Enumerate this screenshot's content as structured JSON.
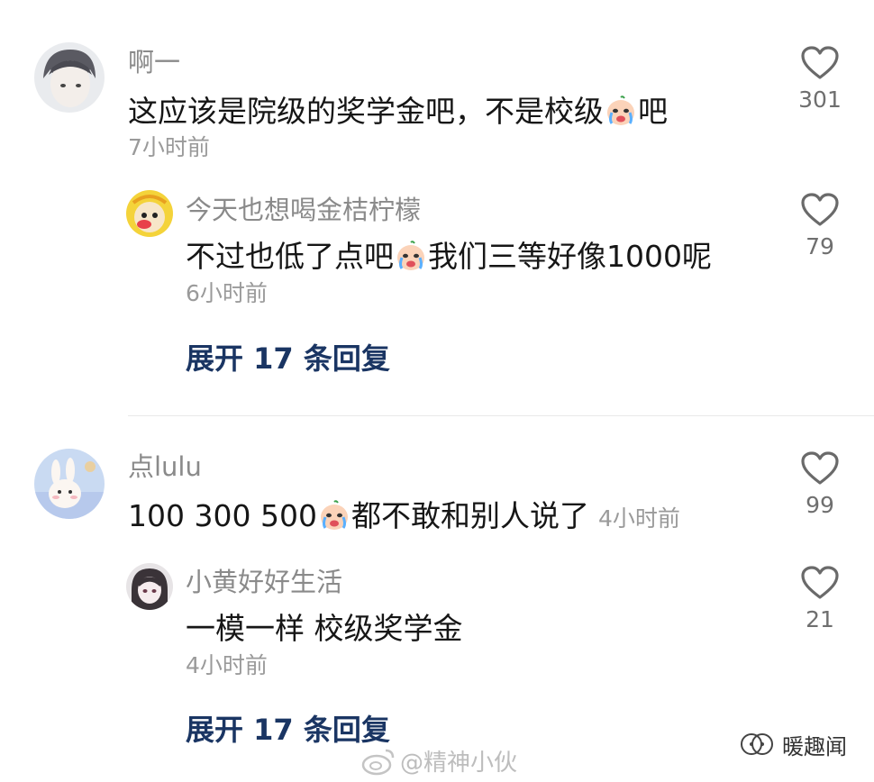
{
  "comments": [
    {
      "username": "啊一",
      "text_before": "这应该是院级的奖学金吧，不是校级",
      "text_after": "吧",
      "time": "7小时前",
      "likes": "301"
    },
    {
      "username": "今天也想喝金桔柠檬",
      "text_before": "不过也低了点吧",
      "text_after": "我们三等好像1000呢",
      "time": "6小时前",
      "likes": "79"
    },
    {
      "username": "点lulu",
      "text_before": "100 300 500",
      "text_after": "都不敢和别人说了",
      "time": "4小时前",
      "likes": "99"
    },
    {
      "username": "小黄好好生活",
      "text": "一模一样 校级奖学金",
      "time": "4小时前",
      "likes": "21"
    }
  ],
  "expand_replies_1": "展开 17 条回复",
  "expand_replies_2": "展开 17 条回复",
  "watermark": "@精神小伙",
  "source_name": "暖趣闻",
  "icons": {
    "like": "heart-outline-icon",
    "emoji": "crying-face-emoji-icon",
    "weibo": "weibo-logo-icon",
    "wechat": "wechat-channel-icon"
  },
  "colors": {
    "username": "#8a8a8a",
    "content": "#161616",
    "time": "#9a9a9a",
    "expand": "#1a3563",
    "heart": "#6a6a6a"
  }
}
